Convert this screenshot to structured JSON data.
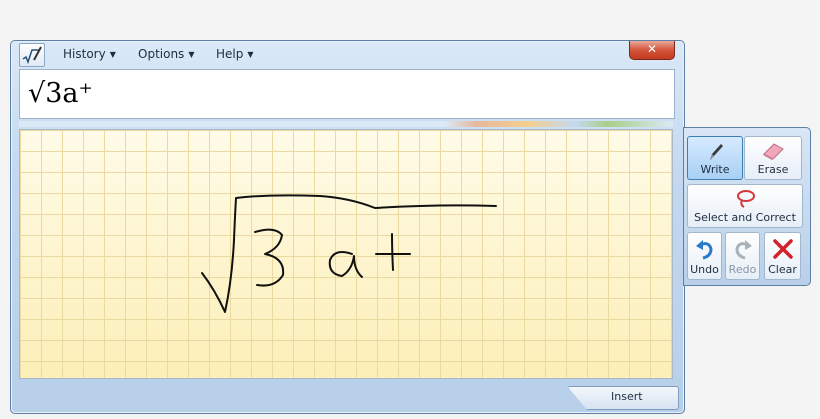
{
  "menu": [
    {
      "label": "History"
    },
    {
      "label": "Options"
    },
    {
      "label": "Help"
    }
  ],
  "window": {
    "close_glyph": "✕"
  },
  "preview": {
    "text": "√3a⁺"
  },
  "tools": {
    "write": "Write",
    "erase": "Erase",
    "select_correct": "Select and Correct",
    "undo": "Undo",
    "redo": "Redo",
    "clear": "Clear"
  },
  "footer": {
    "insert": "Insert"
  },
  "colors": {
    "accent": "#3c7fb1",
    "canvas": "#fdf5cf",
    "clear": "#d4202a"
  }
}
